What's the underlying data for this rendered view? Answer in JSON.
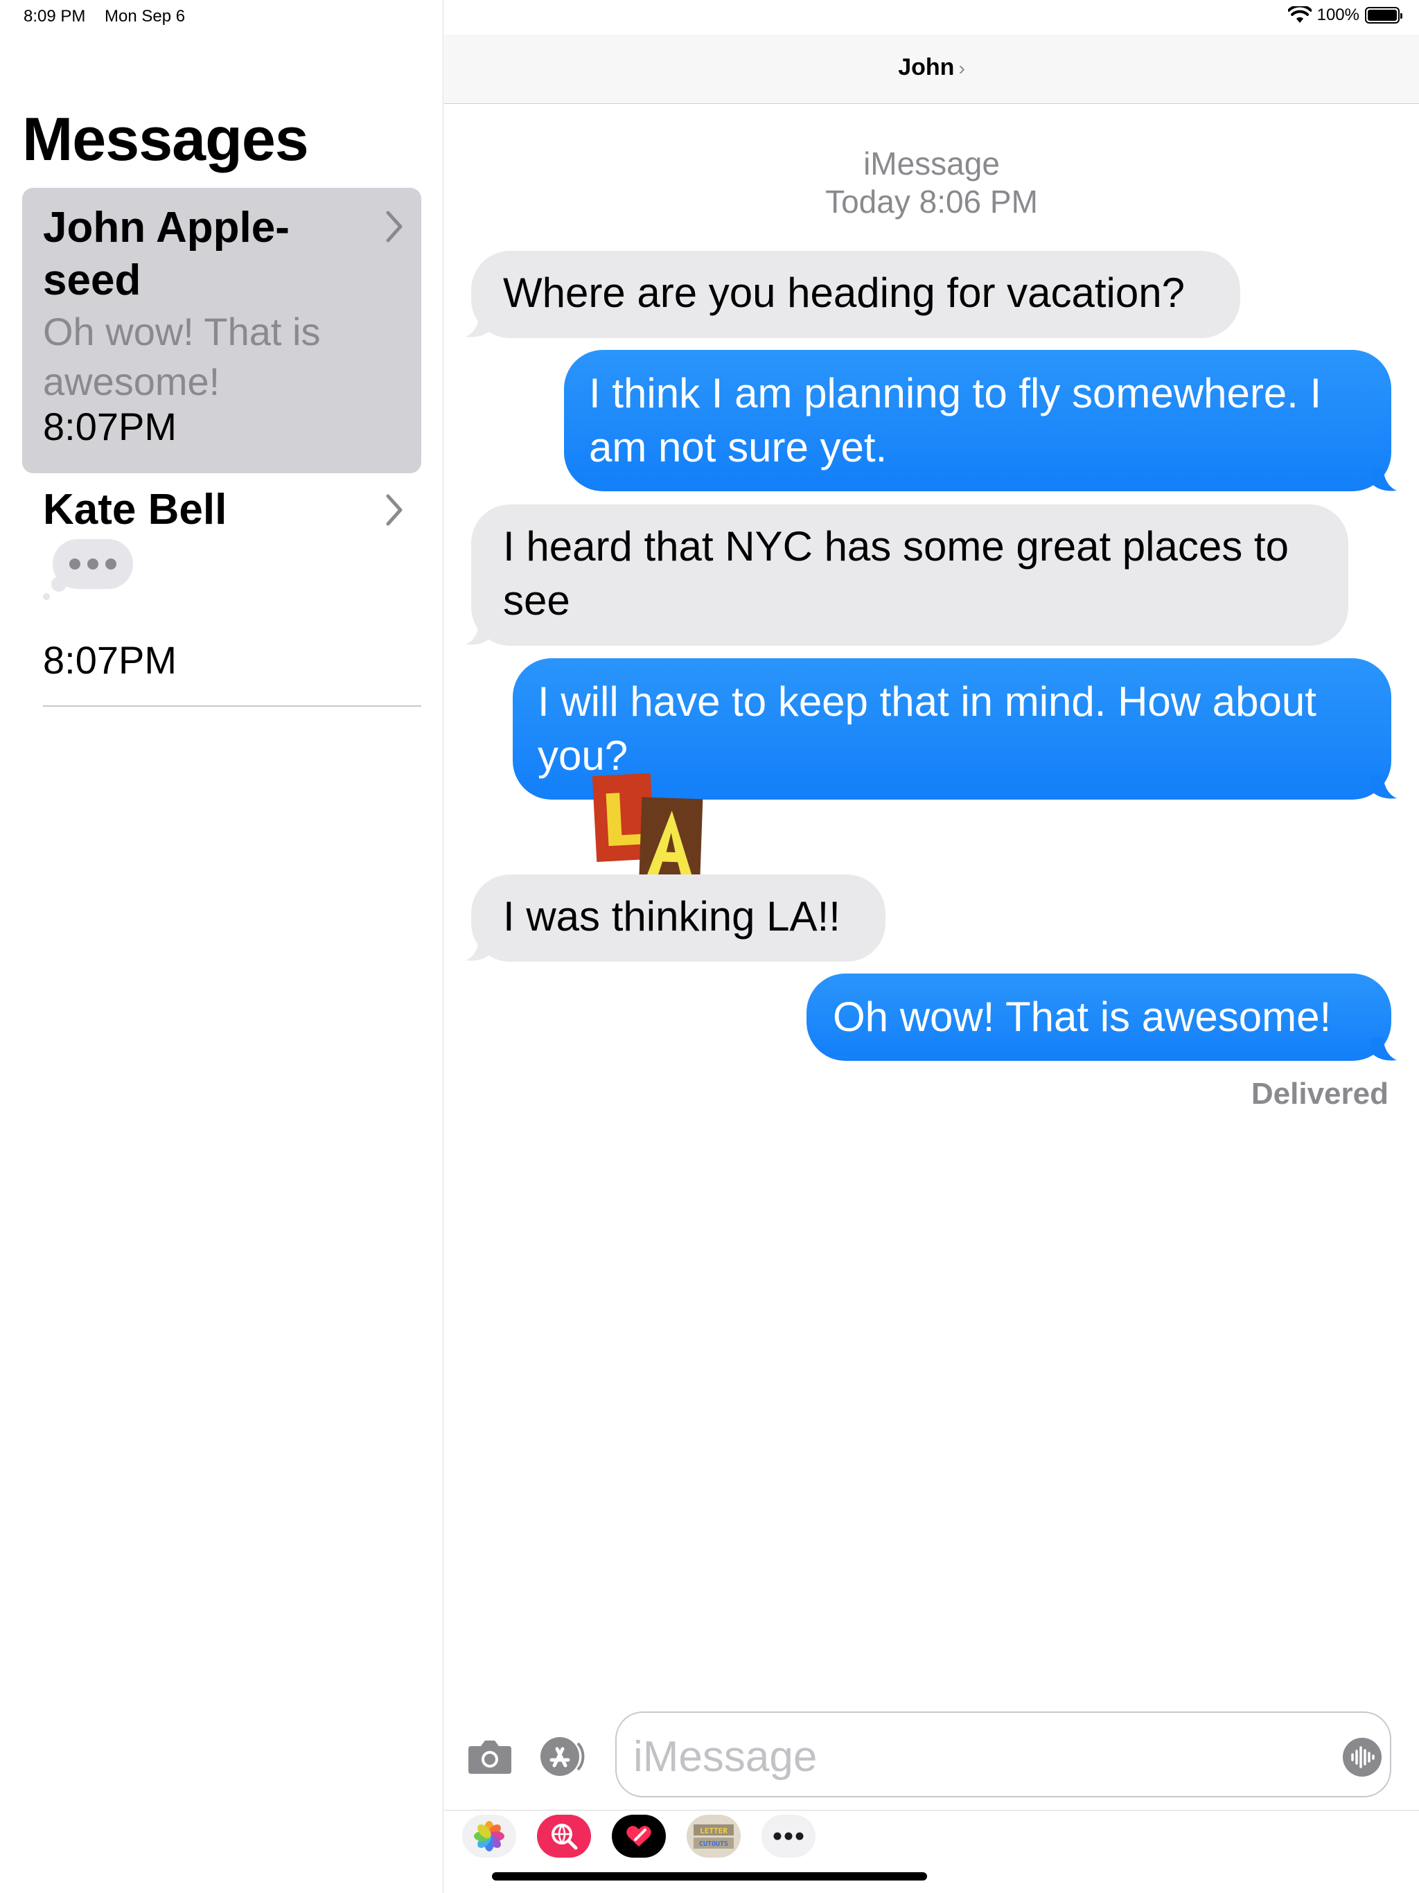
{
  "status_bar": {
    "time": "8:09 PM",
    "date": "Mon Sep 6",
    "battery": "100%"
  },
  "sidebar": {
    "title": "Messages",
    "conversations": [
      {
        "name": "John Apple-seed",
        "preview": "Oh wow! That is awesome!",
        "time": "8:07PM"
      },
      {
        "name": "Kate Bell",
        "time": "8:07PM"
      }
    ]
  },
  "chat": {
    "contact": "John",
    "service": "iMessage",
    "timestamp": "Today 8:06 PM",
    "messages": [
      {
        "dir": "in",
        "text": "Where are you heading for vacation?"
      },
      {
        "dir": "out",
        "text": "I think I am planning to fly somewhere. I am not sure yet."
      },
      {
        "dir": "in",
        "text": "I heard that NYC has some great places to see"
      },
      {
        "dir": "out",
        "text": "I will have to keep that in mind. How about you?"
      },
      {
        "dir": "in",
        "text": "I was thinking LA!!"
      },
      {
        "dir": "out",
        "text": "Oh wow! That is awesome!"
      }
    ],
    "delivered": "Delivered",
    "sticker_text": "LA"
  },
  "composer": {
    "placeholder": "iMessage",
    "icons": [
      "camera-icon",
      "app-store-icon",
      "audio-waveform-icon"
    ]
  },
  "app_strip": {
    "apps": [
      "photos-app-icon",
      "web-images-app-icon",
      "digital-touch-app-icon",
      "letter-cutouts-app-icon",
      "more-apps-icon"
    ],
    "letter_cutouts_text_top": "LETTER",
    "letter_cutouts_text_bottom": "CUTOUTS"
  },
  "colors": {
    "outgoing": "#1a84fa",
    "incoming": "#e9e9eb",
    "selected_row": "#d1d1d6"
  }
}
